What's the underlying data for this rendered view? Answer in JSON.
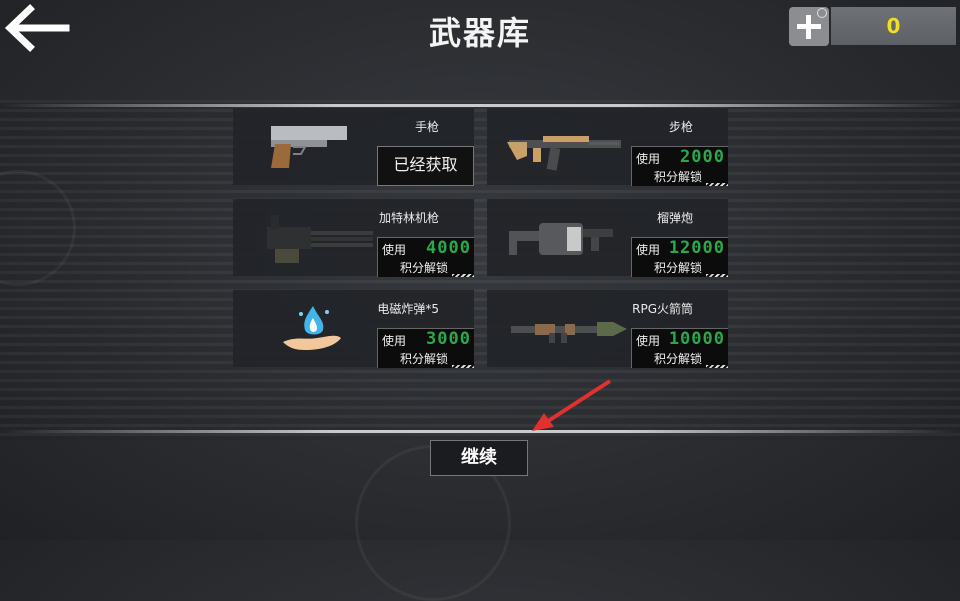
{
  "header": {
    "title": "武器库",
    "currency_value": "0"
  },
  "weapons": [
    {
      "name": "手枪",
      "icon": "pistol-icon",
      "status": "owned",
      "owned_label": "已经获取"
    },
    {
      "name": "步枪",
      "icon": "rifle-icon",
      "status": "locked",
      "use_label": "使用",
      "cost": "2000",
      "unlock_label": "积分解锁"
    },
    {
      "name": "加特林机枪",
      "icon": "gatling-gun-icon",
      "status": "locked",
      "use_label": "使用",
      "cost": "4000",
      "unlock_label": "积分解锁"
    },
    {
      "name": "榴弹炮",
      "icon": "grenade-launcher-icon",
      "status": "locked",
      "use_label": "使用",
      "cost": "12000",
      "unlock_label": "积分解锁"
    },
    {
      "name": "电磁炸弹*5",
      "icon": "emp-bomb-icon",
      "status": "locked",
      "use_label": "使用",
      "cost": "3000",
      "unlock_label": "积分解锁"
    },
    {
      "name": "RPG火箭筒",
      "icon": "rpg-launcher-icon",
      "status": "locked",
      "use_label": "使用",
      "cost": "10000",
      "unlock_label": "积分解锁"
    }
  ],
  "continue_label": "继续",
  "colors": {
    "cost_green": "#2aa84c",
    "currency_yellow": "#f0e020",
    "arrow_red": "#e0312f"
  }
}
